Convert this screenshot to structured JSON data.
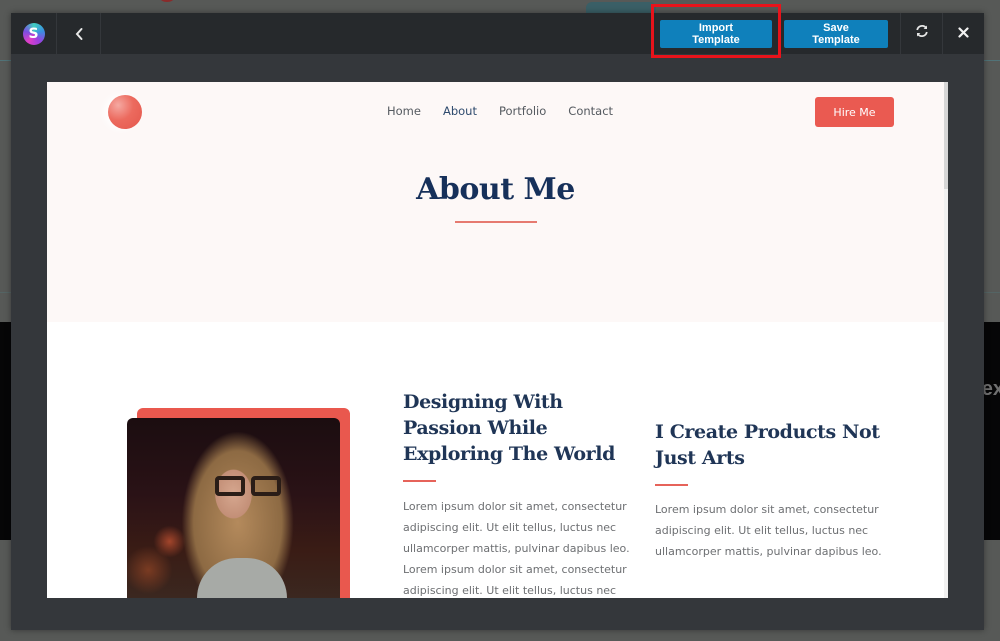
{
  "toolbar": {
    "logo_letter": "S",
    "import_label": "Import Template",
    "save_label": "Save Template",
    "icons": {
      "back": "chevron-left-icon",
      "refresh": "refresh-icon",
      "close": "close-icon"
    }
  },
  "preview": {
    "nav": {
      "items": [
        {
          "label": "Home"
        },
        {
          "label": "About",
          "active": true
        },
        {
          "label": "Portfolio"
        },
        {
          "label": "Contact"
        }
      ],
      "cta_label": "Hire Me"
    },
    "hero": {
      "title": "About Me"
    },
    "columns": [
      {
        "heading": "Designing With Passion While Exploring The World",
        "text": "Lorem ipsum dolor sit amet, consectetur adipiscing elit. Ut elit tellus, luctus nec ullamcorper mattis, pulvinar dapibus leo. Lorem ipsum dolor sit amet, consectetur adipiscing elit. Ut elit tellus, luctus nec"
      },
      {
        "heading": "I Create Products Not Just Arts",
        "text": "Lorem ipsum dolor sit amet, consectetur adipiscing elit. Ut elit tellus, luctus nec ullamcorper mattis, pulvinar dapibus leo."
      }
    ]
  },
  "background": {
    "partial_text": "ex"
  },
  "colors": {
    "primary_button": "#0f80bb",
    "highlight_box": "#e8131b",
    "accent": "#ea5a51",
    "heading": "#16305a"
  }
}
